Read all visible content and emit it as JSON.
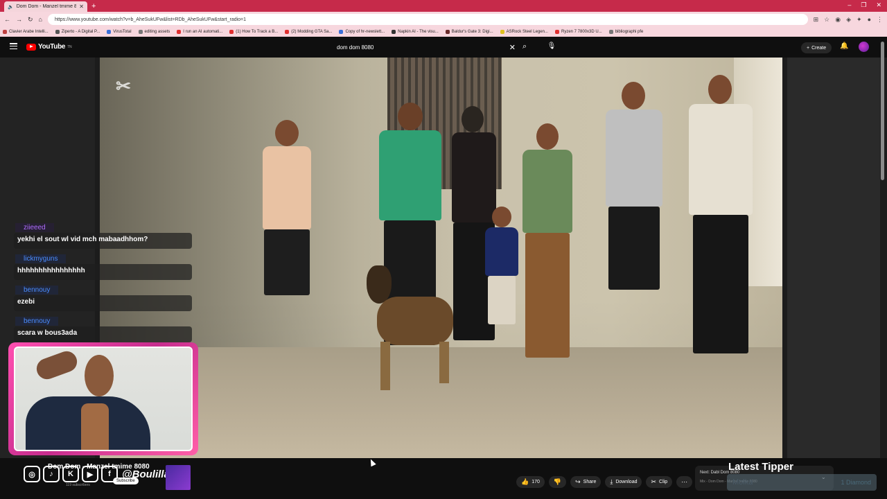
{
  "browser": {
    "tab_title": "Dom Dom - Manzel tmime 8",
    "url": "https://www.youtube.com/watch?v=b_AheSukUFw&list=RDb_AheSukUFw&start_radio=1",
    "bookmarks": [
      "Clavier Arabe Intelli...",
      "Ziperto - A Digital P...",
      "VirusTotal",
      "editing assets",
      "I run an AI automati...",
      "(1) How To Track a B...",
      "(2) Modding GTA Sa...",
      "Copy of hr-newslett...",
      "Napkin AI - The visu...",
      "Baldur's Gate 3: Digi...",
      "ASRock Steel Legen...",
      "Ryzen 7 7800x3D U...",
      "bibliographi pfe"
    ]
  },
  "header": {
    "logo_text": "YouTube",
    "logo_sup": "TN",
    "search_value": "dom dom 8080",
    "create_label": "Create"
  },
  "chat": {
    "messages": [
      {
        "user": "ziieeed",
        "text": "yekhi el sout wl vid mch mabaadhhom?",
        "color": "#b06bff"
      },
      {
        "user": "lickmyguns",
        "text": "hhhhhhhhhhhhhhhh",
        "color": "#4a8cff"
      },
      {
        "user": "bennouy",
        "text": "ezebi",
        "color": "#4a8cff"
      },
      {
        "user": "bennouy",
        "text": "scara w bous3ada",
        "color": "#4a8cff"
      }
    ]
  },
  "video": {
    "title": "Dom Dom - Manzel tmime 8080",
    "subscribers": "119 subscribers",
    "subscribe_label": "Subscribe"
  },
  "overlay": {
    "handle": "@Boulilla",
    "latest_tipper_title": "Latest Tipper",
    "tipper_name": "Molka",
    "tipper_amount": "1 Diamond"
  },
  "actions": {
    "like_count": "170",
    "share_label": "Share",
    "download_label": "Download",
    "clip_label": "Clip"
  },
  "next": {
    "label": "Next: Dabl Dom 8080",
    "sub": "Mix - Dom Dom - Manzel tmime 8080"
  },
  "colors": {
    "tabbar": "#c62a4a",
    "webcam_frame": "#ff4fb0",
    "youtube_red": "#ff0000"
  }
}
